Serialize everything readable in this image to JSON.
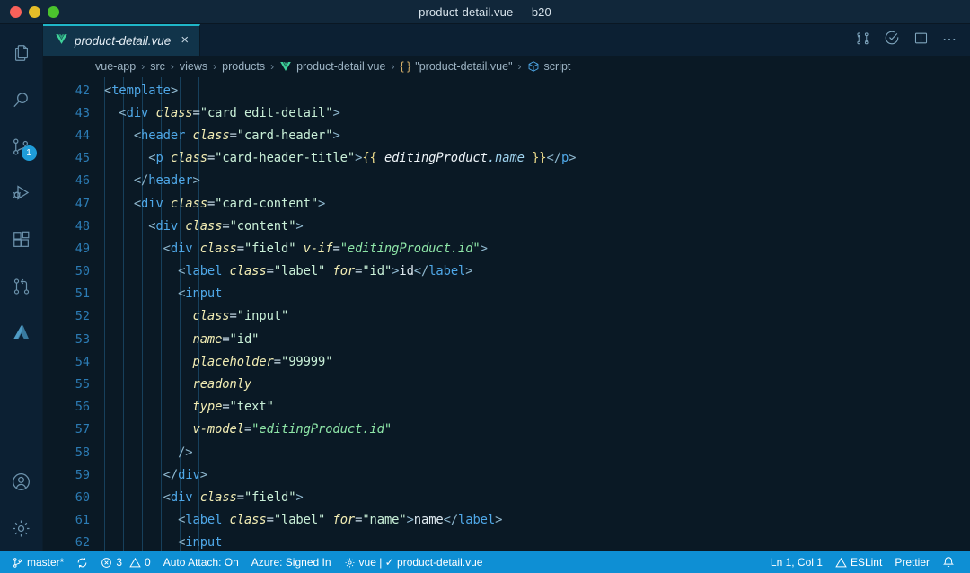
{
  "window": {
    "title": "product-detail.vue — b20",
    "traffic_lights": [
      "close",
      "minimize",
      "zoom"
    ],
    "colors": {
      "close": "#f8615a",
      "minimize": "#e5bd28",
      "zoom": "#4bc32d",
      "titlebar_bg": "#11273a",
      "editor_bg": "#0a1925",
      "activitybar_bg": "#0c2033",
      "statusbar_bg": "#0e8fd4",
      "tab_active_border": "#1fb6c8",
      "accent_badge": "#1f9cd8"
    }
  },
  "activitybar": {
    "items": [
      {
        "name": "explorer",
        "icon": "files-icon",
        "badge": null
      },
      {
        "name": "search",
        "icon": "search-icon",
        "badge": null
      },
      {
        "name": "source-control",
        "icon": "source-control-icon",
        "badge": "1"
      },
      {
        "name": "run-and-debug",
        "icon": "run-debug-icon",
        "badge": null
      },
      {
        "name": "extensions",
        "icon": "extensions-icon",
        "badge": null
      },
      {
        "name": "pull-requests",
        "icon": "pull-request-icon",
        "badge": null
      },
      {
        "name": "azure",
        "icon": "azure-icon",
        "badge": null
      }
    ],
    "bottom_items": [
      {
        "name": "accounts",
        "icon": "account-icon"
      },
      {
        "name": "manage-settings",
        "icon": "gear-icon"
      }
    ]
  },
  "tabs": [
    {
      "label": "product-detail.vue",
      "icon": "vue-icon",
      "active": true,
      "close_glyph": "×"
    }
  ],
  "editor_actions": [
    {
      "name": "open-changes",
      "icon": "compare-changes-icon"
    },
    {
      "name": "validate",
      "icon": "check-circle-icon"
    },
    {
      "name": "split-editor",
      "icon": "split-editor-icon"
    },
    {
      "name": "more-actions",
      "icon": "ellipsis-icon",
      "glyph": "⋯"
    }
  ],
  "breadcrumbs": {
    "separator": "›",
    "items": [
      {
        "label": "vue-app",
        "icon": null
      },
      {
        "label": "src",
        "icon": null
      },
      {
        "label": "views",
        "icon": null
      },
      {
        "label": "products",
        "icon": null
      },
      {
        "label": "product-detail.vue",
        "icon": "vue-icon"
      },
      {
        "label": "\"product-detail.vue\"",
        "icon": "braces-icon"
      },
      {
        "label": "script",
        "icon": "symbol-module-icon"
      }
    ]
  },
  "code": {
    "first_line_number": 42,
    "lines": [
      {
        "n": 42,
        "indent": 0,
        "tokens": [
          {
            "t": "punct",
            "v": "<"
          },
          {
            "t": "tag",
            "v": "template"
          },
          {
            "t": "punct",
            "v": ">"
          }
        ]
      },
      {
        "n": 43,
        "indent": 1,
        "tokens": [
          {
            "t": "punct",
            "v": "  <"
          },
          {
            "t": "tag",
            "v": "div"
          },
          {
            "t": "text",
            "v": " "
          },
          {
            "t": "attr",
            "v": "class"
          },
          {
            "t": "eq",
            "v": "="
          },
          {
            "t": "str",
            "v": "\"card edit-detail\""
          },
          {
            "t": "punct",
            "v": ">"
          }
        ]
      },
      {
        "n": 44,
        "indent": 2,
        "tokens": [
          {
            "t": "punct",
            "v": "    <"
          },
          {
            "t": "tag",
            "v": "header"
          },
          {
            "t": "text",
            "v": " "
          },
          {
            "t": "attr",
            "v": "class"
          },
          {
            "t": "eq",
            "v": "="
          },
          {
            "t": "str",
            "v": "\"card-header\""
          },
          {
            "t": "punct",
            "v": ">"
          }
        ]
      },
      {
        "n": 45,
        "indent": 3,
        "tokens": [
          {
            "t": "punct",
            "v": "      <"
          },
          {
            "t": "tag",
            "v": "p"
          },
          {
            "t": "text",
            "v": " "
          },
          {
            "t": "attr",
            "v": "class"
          },
          {
            "t": "eq",
            "v": "="
          },
          {
            "t": "str",
            "v": "\"card-header-title\""
          },
          {
            "t": "punct",
            "v": ">"
          },
          {
            "t": "brace",
            "v": "{{"
          },
          {
            "t": "var",
            "v": " editingProduct"
          },
          {
            "t": "prop",
            "v": ".name"
          },
          {
            "t": "brace",
            "v": " }}"
          },
          {
            "t": "punct",
            "v": "</"
          },
          {
            "t": "tag",
            "v": "p"
          },
          {
            "t": "punct",
            "v": ">"
          }
        ]
      },
      {
        "n": 46,
        "indent": 2,
        "tokens": [
          {
            "t": "punct",
            "v": "    </"
          },
          {
            "t": "tag",
            "v": "header"
          },
          {
            "t": "punct",
            "v": ">"
          }
        ]
      },
      {
        "n": 47,
        "indent": 2,
        "tokens": [
          {
            "t": "punct",
            "v": "    <"
          },
          {
            "t": "tag",
            "v": "div"
          },
          {
            "t": "text",
            "v": " "
          },
          {
            "t": "attr",
            "v": "class"
          },
          {
            "t": "eq",
            "v": "="
          },
          {
            "t": "str",
            "v": "\"card-content\""
          },
          {
            "t": "punct",
            "v": ">"
          }
        ]
      },
      {
        "n": 48,
        "indent": 3,
        "tokens": [
          {
            "t": "punct",
            "v": "      <"
          },
          {
            "t": "tag",
            "v": "div"
          },
          {
            "t": "text",
            "v": " "
          },
          {
            "t": "attr",
            "v": "class"
          },
          {
            "t": "eq",
            "v": "="
          },
          {
            "t": "str",
            "v": "\"content\""
          },
          {
            "t": "punct",
            "v": ">"
          }
        ]
      },
      {
        "n": 49,
        "indent": 4,
        "tokens": [
          {
            "t": "punct",
            "v": "        <"
          },
          {
            "t": "tag",
            "v": "div"
          },
          {
            "t": "text",
            "v": " "
          },
          {
            "t": "attr",
            "v": "class"
          },
          {
            "t": "eq",
            "v": "="
          },
          {
            "t": "str",
            "v": "\"field\""
          },
          {
            "t": "text",
            "v": " "
          },
          {
            "t": "attr",
            "v": "v-if"
          },
          {
            "t": "eq",
            "v": "="
          },
          {
            "t": "strexpr",
            "v": "\"editingProduct.id\""
          },
          {
            "t": "punct",
            "v": ">"
          }
        ]
      },
      {
        "n": 50,
        "indent": 5,
        "tokens": [
          {
            "t": "punct",
            "v": "          <"
          },
          {
            "t": "tag",
            "v": "label"
          },
          {
            "t": "text",
            "v": " "
          },
          {
            "t": "attr",
            "v": "class"
          },
          {
            "t": "eq",
            "v": "="
          },
          {
            "t": "str",
            "v": "\"label\""
          },
          {
            "t": "text",
            "v": " "
          },
          {
            "t": "attr",
            "v": "for"
          },
          {
            "t": "eq",
            "v": "="
          },
          {
            "t": "str",
            "v": "\"id\""
          },
          {
            "t": "punct",
            "v": ">"
          },
          {
            "t": "text",
            "v": "id"
          },
          {
            "t": "punct",
            "v": "</"
          },
          {
            "t": "tag",
            "v": "label"
          },
          {
            "t": "punct",
            "v": ">"
          }
        ]
      },
      {
        "n": 51,
        "indent": 5,
        "tokens": [
          {
            "t": "punct",
            "v": "          <"
          },
          {
            "t": "tag",
            "v": "input"
          }
        ]
      },
      {
        "n": 52,
        "indent": 6,
        "tokens": [
          {
            "t": "text",
            "v": "            "
          },
          {
            "t": "attr",
            "v": "class"
          },
          {
            "t": "eq",
            "v": "="
          },
          {
            "t": "str",
            "v": "\"input\""
          }
        ]
      },
      {
        "n": 53,
        "indent": 6,
        "tokens": [
          {
            "t": "text",
            "v": "            "
          },
          {
            "t": "attr",
            "v": "name"
          },
          {
            "t": "eq",
            "v": "="
          },
          {
            "t": "str",
            "v": "\"id\""
          }
        ]
      },
      {
        "n": 54,
        "indent": 6,
        "tokens": [
          {
            "t": "text",
            "v": "            "
          },
          {
            "t": "attr",
            "v": "placeholder"
          },
          {
            "t": "eq",
            "v": "="
          },
          {
            "t": "str",
            "v": "\"99999\""
          }
        ]
      },
      {
        "n": 55,
        "indent": 6,
        "tokens": [
          {
            "t": "text",
            "v": "            "
          },
          {
            "t": "attr",
            "v": "readonly"
          }
        ]
      },
      {
        "n": 56,
        "indent": 6,
        "tokens": [
          {
            "t": "text",
            "v": "            "
          },
          {
            "t": "attr",
            "v": "type"
          },
          {
            "t": "eq",
            "v": "="
          },
          {
            "t": "str",
            "v": "\"text\""
          }
        ]
      },
      {
        "n": 57,
        "indent": 6,
        "tokens": [
          {
            "t": "text",
            "v": "            "
          },
          {
            "t": "attr",
            "v": "v-model"
          },
          {
            "t": "eq",
            "v": "="
          },
          {
            "t": "strexpr",
            "v": "\"editingProduct.id\""
          }
        ]
      },
      {
        "n": 58,
        "indent": 5,
        "tokens": [
          {
            "t": "punct",
            "v": "          />"
          }
        ]
      },
      {
        "n": 59,
        "indent": 4,
        "tokens": [
          {
            "t": "punct",
            "v": "        </"
          },
          {
            "t": "tag",
            "v": "div"
          },
          {
            "t": "punct",
            "v": ">"
          }
        ]
      },
      {
        "n": 60,
        "indent": 4,
        "tokens": [
          {
            "t": "punct",
            "v": "        <"
          },
          {
            "t": "tag",
            "v": "div"
          },
          {
            "t": "text",
            "v": " "
          },
          {
            "t": "attr",
            "v": "class"
          },
          {
            "t": "eq",
            "v": "="
          },
          {
            "t": "str",
            "v": "\"field\""
          },
          {
            "t": "punct",
            "v": ">"
          }
        ]
      },
      {
        "n": 61,
        "indent": 5,
        "tokens": [
          {
            "t": "punct",
            "v": "          <"
          },
          {
            "t": "tag",
            "v": "label"
          },
          {
            "t": "text",
            "v": " "
          },
          {
            "t": "attr",
            "v": "class"
          },
          {
            "t": "eq",
            "v": "="
          },
          {
            "t": "str",
            "v": "\"label\""
          },
          {
            "t": "text",
            "v": " "
          },
          {
            "t": "attr",
            "v": "for"
          },
          {
            "t": "eq",
            "v": "="
          },
          {
            "t": "str",
            "v": "\"name\""
          },
          {
            "t": "punct",
            "v": ">"
          },
          {
            "t": "text",
            "v": "name"
          },
          {
            "t": "punct",
            "v": "</"
          },
          {
            "t": "tag",
            "v": "label"
          },
          {
            "t": "punct",
            "v": ">"
          }
        ]
      },
      {
        "n": 62,
        "indent": 5,
        "tokens": [
          {
            "t": "punct",
            "v": "          <"
          },
          {
            "t": "tag",
            "v": "input"
          }
        ]
      }
    ]
  },
  "statusbar": {
    "left": [
      {
        "name": "branch",
        "icon": "source-control-icon",
        "label": "master*"
      },
      {
        "name": "sync",
        "icon": "sync-icon",
        "label": ""
      },
      {
        "name": "problems",
        "icon": "error-warning-icons",
        "label": "3",
        "warnings": "0"
      },
      {
        "name": "auto-attach",
        "icon": null,
        "label": "Auto Attach: On"
      },
      {
        "name": "azure-account",
        "icon": null,
        "label": "Azure: Signed In"
      },
      {
        "name": "vetur",
        "icon": "vetur-icon",
        "label": "vue | ✓ product-detail.vue"
      }
    ],
    "right": [
      {
        "name": "cursor-position",
        "icon": null,
        "label": "Ln 1, Col 1"
      },
      {
        "name": "eslint",
        "icon": "warning-icon",
        "label": "ESLint"
      },
      {
        "name": "prettier",
        "icon": null,
        "label": "Prettier"
      },
      {
        "name": "notifications",
        "icon": "bell-icon",
        "label": ""
      }
    ]
  }
}
